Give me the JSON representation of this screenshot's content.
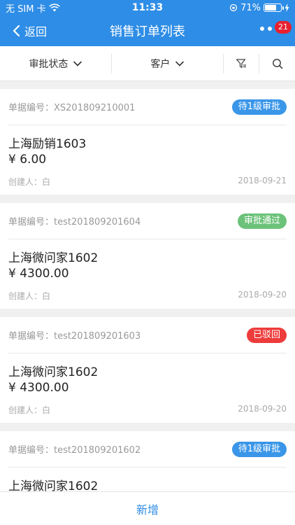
{
  "status_bar": {
    "carrier": "无 SIM 卡",
    "time": "11:33",
    "battery": "71%",
    "battery_level": 0.71
  },
  "nav": {
    "back_label": "返回",
    "title": "销售订单列表",
    "badge": "21"
  },
  "filters": {
    "status_label": "审批状态",
    "customer_label": "客户"
  },
  "colors": {
    "primary": "#2e8de6",
    "pending": "#3a96e8",
    "approved": "#6cc27a",
    "rejected": "#ee3b3b"
  },
  "orders": [
    {
      "doc_no": "单据编号：XS201809210001",
      "status": "待1级审批",
      "status_type": "pending",
      "customer": "上海励销1603",
      "amount": "¥ 6.00",
      "creator": "创建人：白",
      "date": "2018-09-21"
    },
    {
      "doc_no": "单据编号：test201809201604",
      "status": "审批通过",
      "status_type": "approved",
      "customer": "上海微问家1602",
      "amount": "¥ 4300.00",
      "creator": "创建人：白",
      "date": "2018-09-20"
    },
    {
      "doc_no": "单据编号：test201809201603",
      "status": "已驳回",
      "status_type": "rejected",
      "customer": "上海微问家1602",
      "amount": "¥ 4300.00",
      "creator": "创建人：白",
      "date": "2018-09-20"
    },
    {
      "doc_no": "单据编号：test201809201602",
      "status": "待1级审批",
      "status_type": "pending",
      "customer": "上海微问家1602",
      "amount": "",
      "creator": "",
      "date": ""
    }
  ],
  "bottom": {
    "add_label": "新增"
  }
}
